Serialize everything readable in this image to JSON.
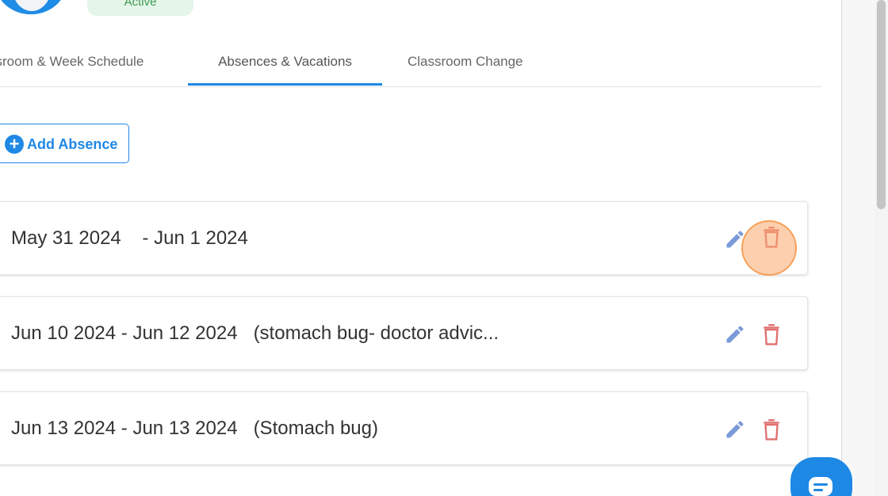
{
  "header": {
    "status_label": "Active"
  },
  "tabs": [
    {
      "label": "ssroom & Week Schedule",
      "active": false
    },
    {
      "label": "Absences & Vacations",
      "active": true
    },
    {
      "label": "Classroom Change",
      "active": false
    }
  ],
  "actions": {
    "add_absence_label": "Add Absence"
  },
  "absences": [
    {
      "text": "May 31 2024    - Jun 1 2024"
    },
    {
      "text": "Jun 10 2024 - Jun 12 2024   (stomach bug- doctor advic..."
    },
    {
      "text": "Jun 13 2024 - Jun 13 2024   (Stomach bug)"
    }
  ],
  "icons": {
    "edit": "pencil-icon",
    "delete": "trash-icon",
    "add": "plus-circle-icon",
    "chat": "chat-icon"
  },
  "colors": {
    "accent": "#1e88e5",
    "edit_icon": "#7b9ad8",
    "delete_icon": "#e07070",
    "status_bg": "#e6f5e9",
    "status_text": "#3a9b4f",
    "highlight": "#f6a65a"
  }
}
